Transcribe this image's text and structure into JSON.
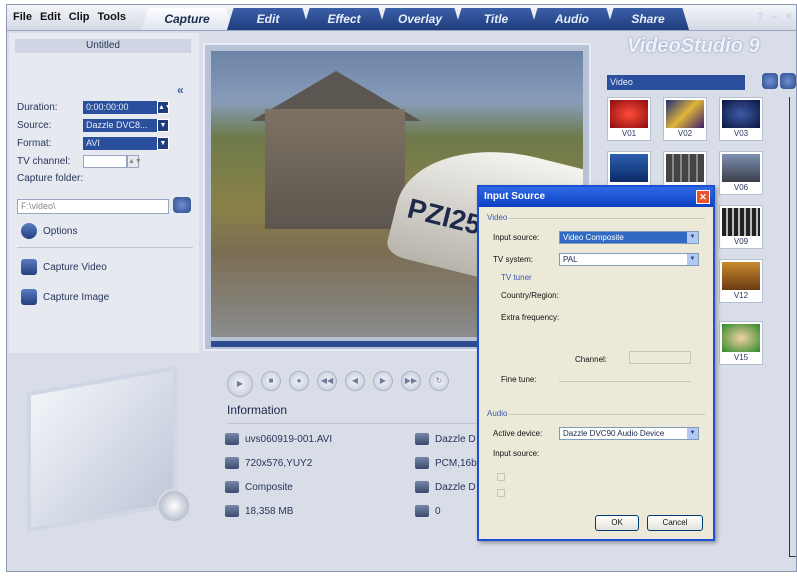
{
  "menu": [
    "File",
    "Edit",
    "Clip",
    "Tools"
  ],
  "tabs": [
    "Capture",
    "Edit",
    "Effect",
    "Overlay",
    "Title",
    "Audio",
    "Share"
  ],
  "window_controls": [
    "?",
    "–",
    "×"
  ],
  "left": {
    "project_title": "Untitled",
    "collapse": "«",
    "duration_label": "Duration:",
    "duration_value": "0:00:00:00",
    "source_label": "Source:",
    "source_value": "Dazzle DVC8...",
    "format_label": "Format:",
    "format_value": "AVI",
    "tv_channel_label": "TV channel:",
    "capture_folder_label": "Capture folder:",
    "capture_folder_value": "F:\\video\\",
    "options": "Options",
    "capture_video": "Capture Video",
    "capture_image": "Capture Image"
  },
  "preview": {
    "boat_text": "PZI25"
  },
  "info": {
    "title": "Information",
    "file": "uvs060919-001.AVI",
    "resolution": "720x576,YUY2",
    "input": "Composite",
    "size": "18,358 MB",
    "device1": "Dazzle D",
    "audio": "PCM,16b",
    "device2": "Dazzle D",
    "count": "0"
  },
  "library": {
    "logo": "VideoStudio 9",
    "select": "Video",
    "items": [
      "V01",
      "V02",
      "V03",
      "",
      "",
      "V06",
      "V09",
      "V12",
      "V15"
    ]
  },
  "dialog": {
    "title": "Input Source",
    "video_group": "Video",
    "input_source_label": "Input source:",
    "input_source_value": "Video Composite",
    "tv_system_label": "TV system:",
    "tv_system_value": "PAL",
    "tv_tuner_group": "TV tuner",
    "country_label": "Country/Region:",
    "extra_freq_label": "Extra frequency:",
    "channel_label": "Channel:",
    "fine_tune_label": "Fine tune:",
    "audio_group": "Audio",
    "active_device_label": "Active device:",
    "active_device_value": "Dazzle DVC90 Audio Device",
    "audio_input_label": "Input source:",
    "ok": "OK",
    "cancel": "Cancel"
  },
  "colors": {
    "accent": "#2a4f9c",
    "dialog_title": "#0b3fc2",
    "close": "#e8542a"
  }
}
